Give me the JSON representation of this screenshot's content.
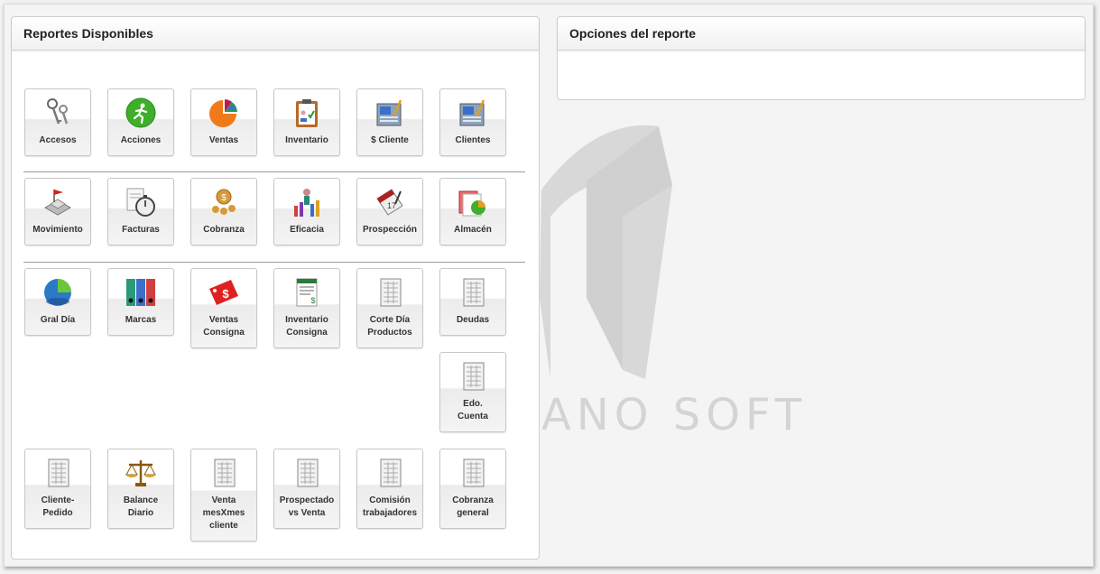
{
  "reportes": {
    "title": "Reportes Disponibles",
    "items": [
      {
        "label": "Accesos",
        "icon": "keys-icon"
      },
      {
        "label": "Acciones",
        "icon": "running-man-icon"
      },
      {
        "label": "Ventas",
        "icon": "pie-chart-icon"
      },
      {
        "label": "Inventario",
        "icon": "clipboard-icon"
      },
      {
        "label": "$ Cliente",
        "icon": "newspaper-pen-icon"
      },
      {
        "label": "Clientes",
        "icon": "newspaper-pen-icon"
      },
      {
        "label": "Movimiento",
        "icon": "flag-boxes-icon"
      },
      {
        "label": "Facturas",
        "icon": "stopwatch-docs-icon"
      },
      {
        "label": "Cobranza",
        "icon": "coins-icon"
      },
      {
        "label": "Eficacia",
        "icon": "person-bar-chart-icon"
      },
      {
        "label": "Prospección",
        "icon": "calendar-pen-icon"
      },
      {
        "label": "Almacén",
        "icon": "chart-docs-icon"
      },
      {
        "label": "Gral Día",
        "icon": "globe-chart-icon"
      },
      {
        "label": "Marcas",
        "icon": "binders-icon"
      },
      {
        "label": "Ventas\nConsigna",
        "icon": "price-tag-icon"
      },
      {
        "label": "Inventario\nConsigna",
        "icon": "invoice-icon"
      },
      {
        "label": "Corte Día\nProductos",
        "icon": "spreadsheet-icon"
      },
      {
        "label": "Deudas",
        "icon": "spreadsheet-icon"
      },
      {
        "label": "Edo.\nCuenta",
        "icon": "spreadsheet-icon"
      },
      {
        "label": "Cliente-\nPedido",
        "icon": "spreadsheet-icon"
      },
      {
        "label": "Balance\nDiario",
        "icon": "scale-icon"
      },
      {
        "label": "Venta\nmesXmes\ncliente",
        "icon": "spreadsheet-icon"
      },
      {
        "label": "Prospectado\nvs Venta",
        "icon": "spreadsheet-icon"
      },
      {
        "label": "Comisión\ntrabajadores",
        "icon": "spreadsheet-icon"
      },
      {
        "label": "Cobranza\ngeneral",
        "icon": "spreadsheet-icon"
      }
    ]
  },
  "opciones": {
    "title": "Opciones del reporte"
  },
  "watermark": {
    "text": "ANO SOFT"
  },
  "colors": {
    "border": "#cfcfcf",
    "header_text": "#222222",
    "separator": "#9a9a9a"
  }
}
